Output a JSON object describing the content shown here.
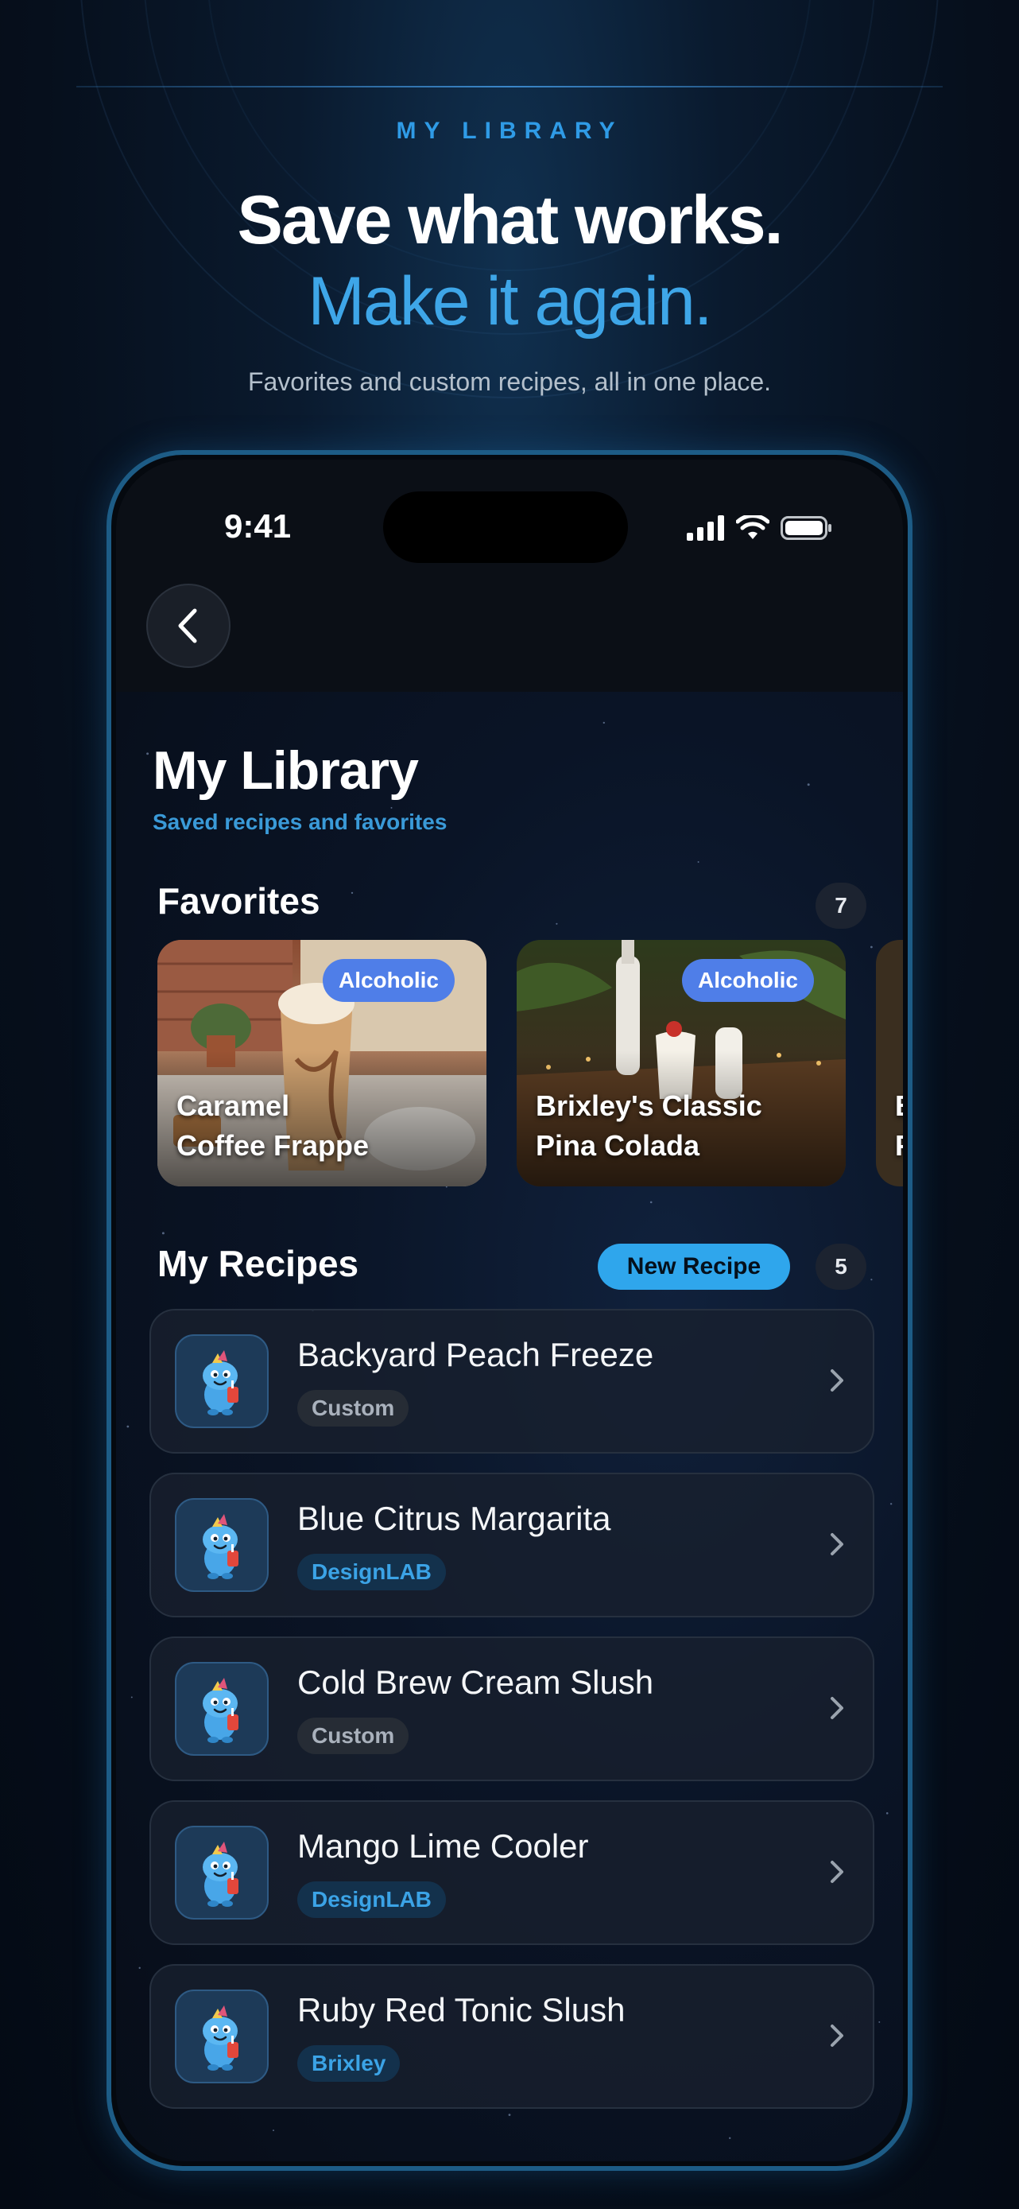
{
  "promo": {
    "eyebrow": "MY LIBRARY",
    "headline_1": "Save what works.",
    "headline_2": "Make it again.",
    "subtitle": "Favorites and custom recipes, all in one place."
  },
  "status_bar": {
    "time": "9:41"
  },
  "page": {
    "title": "My Library",
    "subtitle": "Saved recipes and favorites"
  },
  "favorites": {
    "title": "Favorites",
    "count": "7",
    "items": [
      {
        "name": "Caramel\nCoffee Frappe",
        "tag": "Alcoholic"
      },
      {
        "name": "Brixley's Classic\nPina Colada",
        "tag": "Alcoholic"
      }
    ],
    "peek_text": "B\nP"
  },
  "my_recipes": {
    "title": "My Recipes",
    "new_label": "New Recipe",
    "count": "5",
    "items": [
      {
        "name": "Backyard Peach Freeze",
        "tag": "Custom"
      },
      {
        "name": "Blue Citrus Margarita",
        "tag": "DesignLAB"
      },
      {
        "name": "Cold Brew Cream Slush",
        "tag": "Custom"
      },
      {
        "name": "Mango Lime Cooler",
        "tag": "DesignLAB"
      },
      {
        "name": "Ruby Red Tonic Slush",
        "tag": "Brixley"
      }
    ]
  },
  "colors": {
    "accent": "#2fa6ec",
    "tag_alcoholic": "#4f7ee8",
    "background": "#060f1c"
  },
  "icons": [
    "back-chevron-icon",
    "signal-icon",
    "wifi-icon",
    "battery-icon",
    "mascot-icon",
    "chevron-right-icon"
  ]
}
